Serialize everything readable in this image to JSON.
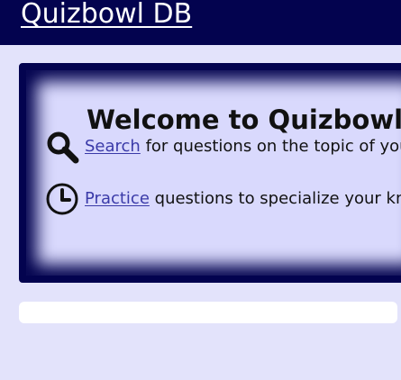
{
  "header": {
    "site_title": "Quizbowl DB"
  },
  "welcome": {
    "title": "Welcome to Quizbowl DB, th",
    "features": [
      {
        "icon": "magnifier-icon",
        "link_label": "Search",
        "description": "for questions on the topic of your cl"
      },
      {
        "icon": "clock-icon",
        "link_label": "Practice",
        "description": "questions to specialize your know"
      }
    ]
  },
  "colors": {
    "header_bg": "#03034f",
    "page_bg": "#e3e3fb",
    "card_bg": "#d9d9fd",
    "link": "#3a3aa8"
  }
}
